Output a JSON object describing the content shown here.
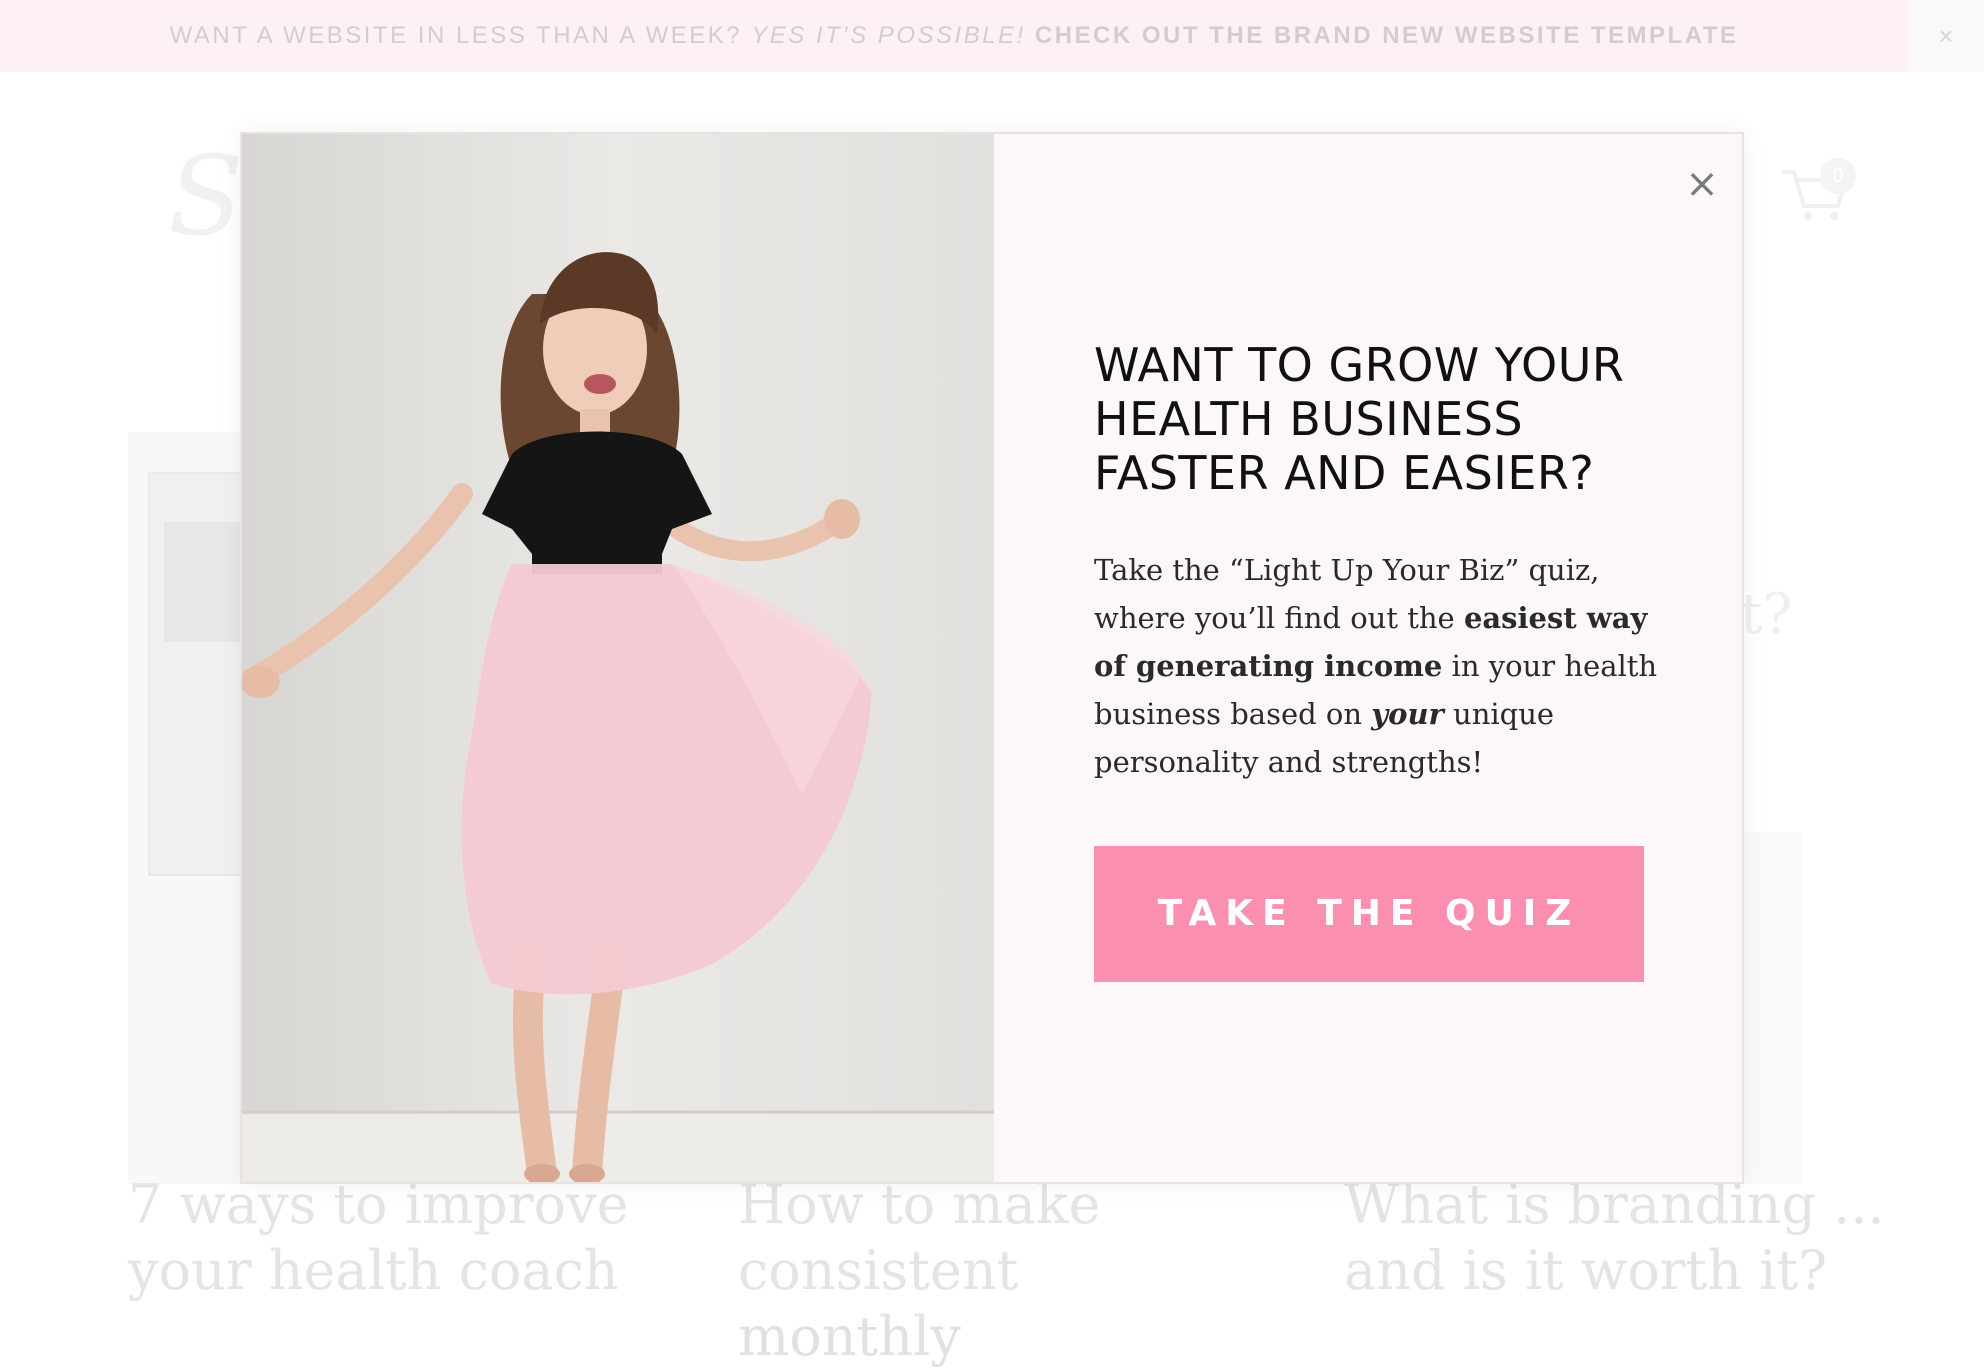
{
  "announcement": {
    "text_plain": "WANT A WEBSITE IN LESS THAN A WEEK?",
    "text_italic": "YES IT’S POSSIBLE!",
    "text_bold": "CHECK OUT THE BRAND NEW WEBSITE TEMPLATE",
    "close_glyph": "×"
  },
  "header": {
    "cart_count": "0"
  },
  "background_posts": [
    {
      "title_line1": "7 ways to improve",
      "title_line2": "your health coach"
    },
    {
      "title_line1": "How to make",
      "title_line2": "consistent monthly"
    },
    {
      "title_line1": "What is branding ...",
      "title_line2": "and is it worth it?"
    }
  ],
  "ghost_text": {
    "question_mark_fragment": "t?"
  },
  "modal": {
    "close_glyph": "×",
    "heading": "WANT TO GROW YOUR HEALTH BUSINESS FASTER AND EASIER?",
    "copy": {
      "part1": "Take the “Light Up Your Biz” quiz, where you’ll find out the ",
      "bold1": "easiest way of generating income",
      "part2": " in your health business based on ",
      "italic1": "your",
      "part3": " unique personality and strengths!"
    },
    "cta_label": "TAKE THE QUIZ",
    "colors": {
      "cta_background": "#fa8fb0",
      "panel_background": "#fdf8f8",
      "skirt": "#f4c9d2",
      "top": "#151515"
    }
  }
}
